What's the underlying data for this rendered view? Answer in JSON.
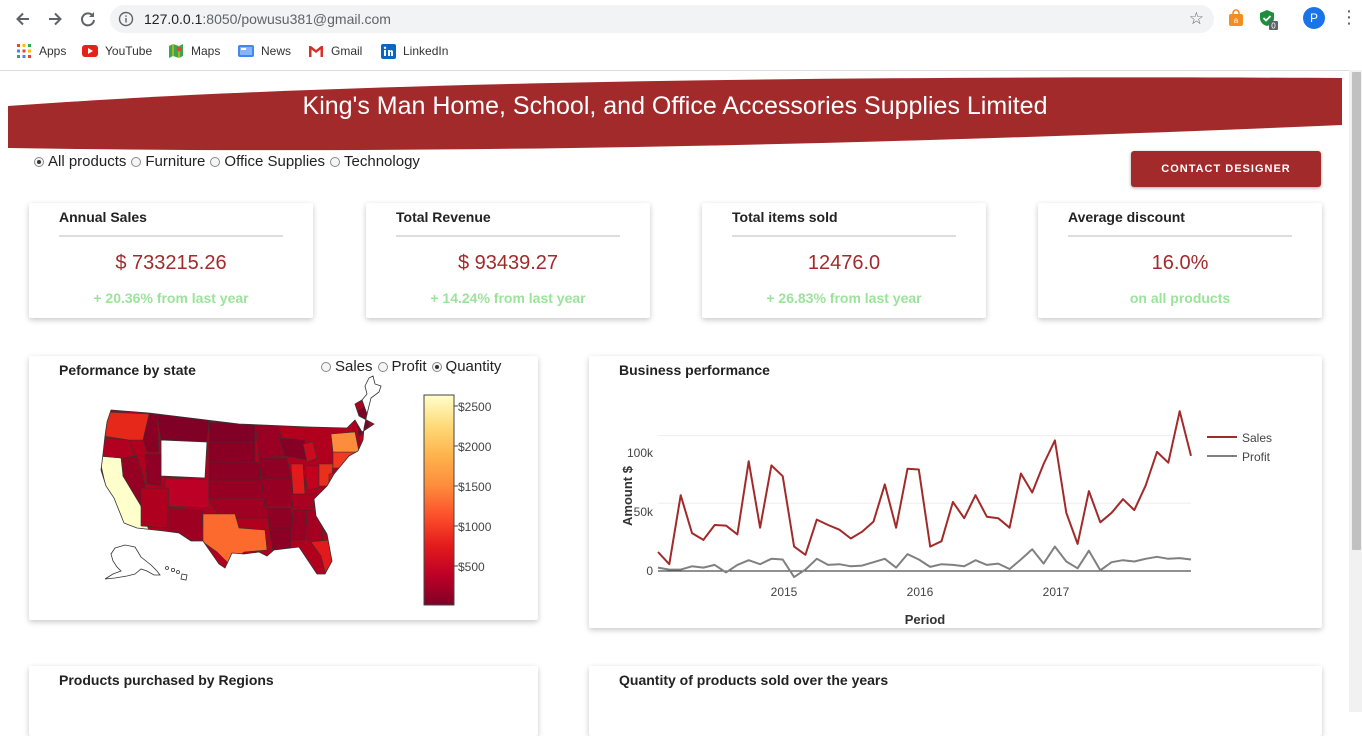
{
  "browser": {
    "url_host": "127.0.0.1",
    "url_rest": ":8050/powusu381@gmail.com",
    "profile_initial": "P",
    "bookmarks": [
      {
        "label": "Apps",
        "icon": "apps-grid-icon"
      },
      {
        "label": "YouTube",
        "icon": "youtube-icon"
      },
      {
        "label": "Maps",
        "icon": "maps-icon"
      },
      {
        "label": "News",
        "icon": "news-icon"
      },
      {
        "label": "Gmail",
        "icon": "gmail-icon"
      },
      {
        "label": "LinkedIn",
        "icon": "linkedin-icon"
      }
    ]
  },
  "header": {
    "title": "King's Man Home, School, and Office Accessories Supplies Limited",
    "contact_button": "CONTACT DESIGNER"
  },
  "filters": {
    "options": [
      "All products",
      "Furniture",
      "Office Supplies",
      "Technology"
    ],
    "selected": "All products"
  },
  "kpis": [
    {
      "title": "Annual Sales",
      "value": "$ 733215.26",
      "sub": "+ 20.36% from last year"
    },
    {
      "title": "Total Revenue",
      "value": "$ 93439.27",
      "sub": "+ 14.24% from last year"
    },
    {
      "title": "Total items sold",
      "value": "12476.0",
      "sub": "+ 26.83% from last year"
    },
    {
      "title": "Average discount",
      "value": "16.0%",
      "sub": "on all products"
    }
  ],
  "map_card": {
    "title": "Peformance by state",
    "options": [
      "Sales",
      "Profit",
      "Quantity"
    ],
    "selected": "Quantity",
    "colorbar_ticks": [
      "$2500",
      "$2000",
      "$1500",
      "$1000",
      "$500"
    ],
    "colorscale": [
      "#800026",
      "#bd0026",
      "#e31a1c",
      "#fc4e2a",
      "#fd8d3c",
      "#feb24c",
      "#fed976",
      "#ffffcc"
    ]
  },
  "business_card": {
    "title": "Business performance",
    "chart_data": {
      "type": "line",
      "xlabel": "Period",
      "ylabel": "Amount $",
      "x_ticks": [
        "2015",
        "2016",
        "2017"
      ],
      "y_ticks": [
        "0",
        "50k",
        "100k"
      ],
      "ylim": [
        0,
        130000
      ],
      "x_start": "2014-01",
      "x_end": "2017-12",
      "legend_position": "right",
      "series": [
        {
          "name": "Sales",
          "color": "#a32a2a",
          "values": [
            14000,
            5000,
            56000,
            28000,
            23000,
            34000,
            33500,
            27000,
            81000,
            32000,
            78000,
            70000,
            18000,
            12000,
            38000,
            34000,
            30500,
            24000,
            29000,
            36500,
            64000,
            32000,
            75500,
            75000,
            18000,
            22000,
            51000,
            39000,
            56000,
            40000,
            39000,
            32000,
            72000,
            58000,
            79000,
            96500,
            43000,
            20000,
            59000,
            36000,
            43000,
            53000,
            45000,
            63000,
            88000,
            80000,
            118000,
            85000
          ]
        },
        {
          "name": "Profit",
          "color": "#808080",
          "values": [
            2500,
            1000,
            1000,
            3500,
            2500,
            4500,
            -1000,
            4500,
            8000,
            5000,
            9000,
            8500,
            -4500,
            1000,
            9000,
            4500,
            5000,
            3500,
            4000,
            6500,
            9000,
            2500,
            12500,
            8500,
            3000,
            5000,
            4500,
            3500,
            8000,
            4500,
            5500,
            1500,
            8500,
            16000,
            5500,
            18000,
            7000,
            2000,
            15000,
            500,
            6500,
            8000,
            7000,
            9000,
            10500,
            9000,
            9500,
            8500
          ]
        }
      ]
    }
  },
  "bottom_cards": {
    "left_title": "Products purchased by Regions",
    "right_title": "Quantity of products sold over the years"
  }
}
